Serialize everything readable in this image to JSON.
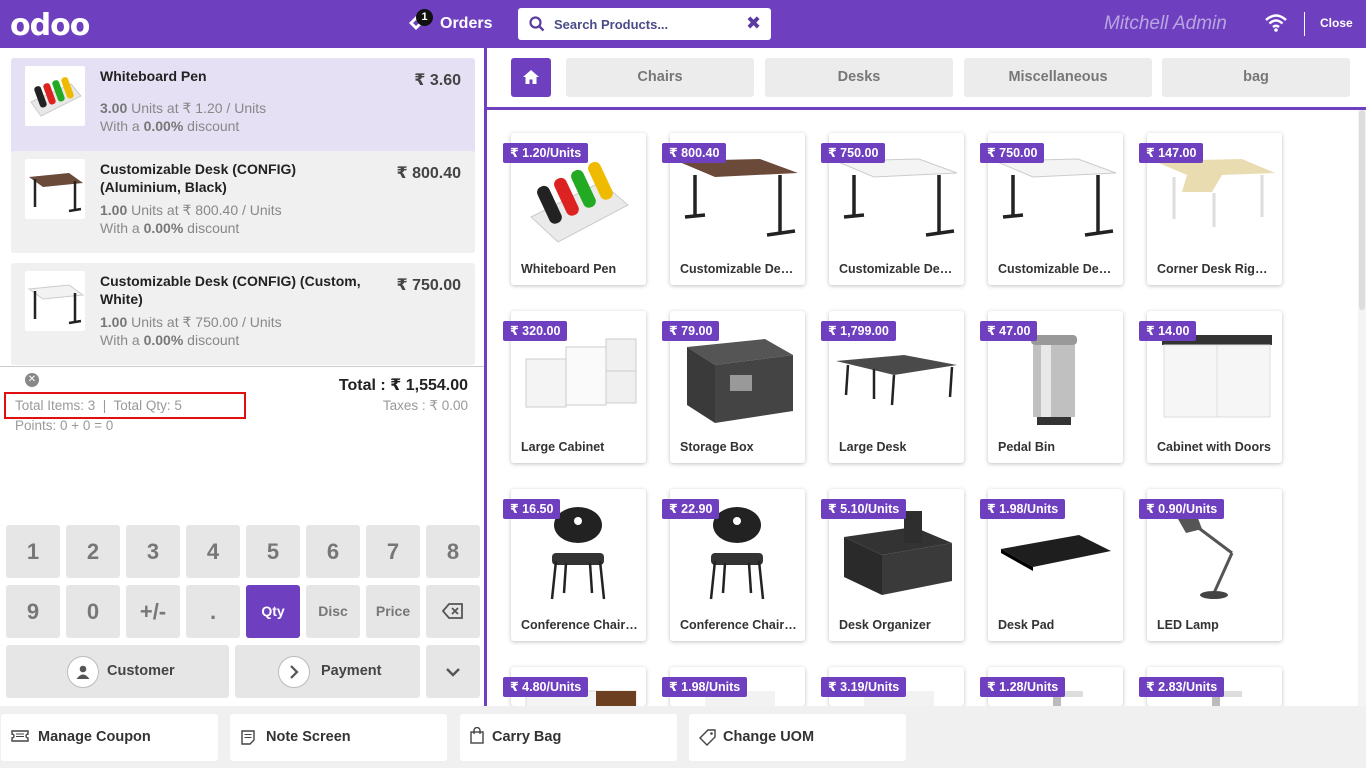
{
  "header": {
    "logo": "odoo",
    "orders_count": "1",
    "orders_label": "Orders",
    "search_placeholder": "Search Products...",
    "user_name": "Mitchell Admin",
    "close_label": "Close"
  },
  "order_lines": [
    {
      "name": "Whiteboard Pen",
      "price": "₹ 3.60",
      "qty": "3.00",
      "qty_rest": " Units at ₹ 1.20 / Units",
      "disc_pre": "With a ",
      "disc": "0.00%",
      "disc_post": " discount"
    },
    {
      "name": "Customizable Desk (CONFIG) (Aluminium, Black)",
      "price": "₹ 800.40",
      "qty": "1.00",
      "qty_rest": " Units at ₹ 800.40 / Units",
      "disc_pre": "With a ",
      "disc": "0.00%",
      "disc_post": " discount"
    },
    {
      "name": "Customizable Desk (CONFIG) (Custom, White)",
      "price": "₹ 750.00",
      "qty": "1.00",
      "qty_rest": " Units at ₹ 750.00 / Units",
      "disc_pre": "With a ",
      "disc": "0.00%",
      "disc_post": " discount"
    }
  ],
  "summary": {
    "total": "Total : ₹ 1,554.00",
    "items": "Total Items: 3  |  Total Qty: 5",
    "taxes": "Taxes : ₹ 0.00",
    "points": "Points: 0 + 0 = 0"
  },
  "numpad": {
    "row1": [
      "1",
      "2",
      "3",
      "4",
      "5",
      "6",
      "7",
      "8"
    ],
    "row2": [
      "9",
      "0",
      "+/-",
      ".",
      "Qty",
      "Disc",
      "Price"
    ],
    "customer": "Customer",
    "payment": "Payment"
  },
  "categories": [
    "Chairs",
    "Desks",
    "Miscellaneous",
    "bag"
  ],
  "products": [
    {
      "name": "Whiteboard Pen",
      "price": "₹ 1.20/Units",
      "icon": "pens"
    },
    {
      "name": "Customizable Desk (CONFIG)",
      "price": "₹ 800.40",
      "icon": "desk-dark"
    },
    {
      "name": "Customizable Desk (CONFIG)",
      "price": "₹ 750.00",
      "icon": "desk-white"
    },
    {
      "name": "Customizable Desk (CONFIG)",
      "price": "₹ 750.00",
      "icon": "desk-white"
    },
    {
      "name": "Corner Desk Right Sit",
      "price": "₹ 147.00",
      "icon": "desk-corner"
    },
    {
      "name": "Large Cabinet",
      "price": "₹ 320.00",
      "icon": "cabinet-white"
    },
    {
      "name": "Storage Box",
      "price": "₹ 79.00",
      "icon": "box"
    },
    {
      "name": "Large Desk",
      "price": "₹ 1,799.00",
      "icon": "desk-large"
    },
    {
      "name": "Pedal Bin",
      "price": "₹ 47.00",
      "icon": "bin"
    },
    {
      "name": "Cabinet with Doors",
      "price": "₹ 14.00",
      "icon": "cabinet-doors"
    },
    {
      "name": "Conference Chair (Aluminium)",
      "price": "₹ 16.50",
      "icon": "chair"
    },
    {
      "name": "Conference Chair (Steel)",
      "price": "₹ 22.90",
      "icon": "chair"
    },
    {
      "name": "Desk Organizer",
      "price": "₹ 5.10/Units",
      "icon": "organizer"
    },
    {
      "name": "Desk Pad",
      "price": "₹ 1.98/Units",
      "icon": "pad"
    },
    {
      "name": "LED Lamp",
      "price": "₹ 0.90/Units",
      "icon": "lamp"
    },
    {
      "name": "",
      "price": "₹ 4.80/Units",
      "icon": "drawer"
    },
    {
      "name": "",
      "price": "₹ 1.98/Units",
      "icon": "blank"
    },
    {
      "name": "",
      "price": "₹ 3.19/Units",
      "icon": "blank"
    },
    {
      "name": "",
      "price": "₹ 1.28/Units",
      "icon": "stand"
    },
    {
      "name": "",
      "price": "₹ 2.83/Units",
      "icon": "stand"
    }
  ],
  "control_buttons": [
    {
      "label": "Manage Coupon",
      "icon": "coupon-icon"
    },
    {
      "label": "Note Screen",
      "icon": "note-icon"
    },
    {
      "label": "Carry Bag",
      "icon": "bag-icon"
    },
    {
      "label": "Change UOM",
      "icon": "tag-icon"
    }
  ]
}
